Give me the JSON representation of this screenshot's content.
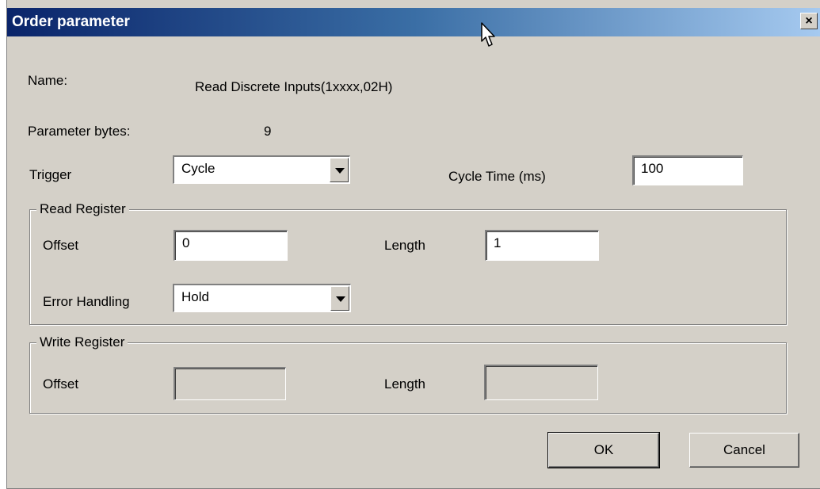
{
  "window": {
    "title": "Order parameter",
    "close_glyph": "×"
  },
  "info": {
    "name_label": "Name:",
    "name_value": "Read Discrete Inputs(1xxxx,02H)",
    "bytes_label": "Parameter bytes:",
    "bytes_value": "9"
  },
  "trigger": {
    "label": "Trigger",
    "value": "Cycle"
  },
  "cycle_time": {
    "label": "Cycle Time (ms)",
    "value": "100"
  },
  "read_register": {
    "title": "Read Register",
    "offset_label": "Offset",
    "offset_value": "0",
    "length_label": "Length",
    "length_value": "1",
    "error_label": "Error Handling",
    "error_value": "Hold"
  },
  "write_register": {
    "title": "Write Register",
    "offset_label": "Offset",
    "offset_value": "",
    "length_label": "Length",
    "length_value": ""
  },
  "buttons": {
    "ok": "OK",
    "cancel": "Cancel"
  },
  "icons": {
    "close": "close-icon",
    "dropdown": "chevron-down-icon",
    "cursor": "mouse-pointer-icon"
  }
}
